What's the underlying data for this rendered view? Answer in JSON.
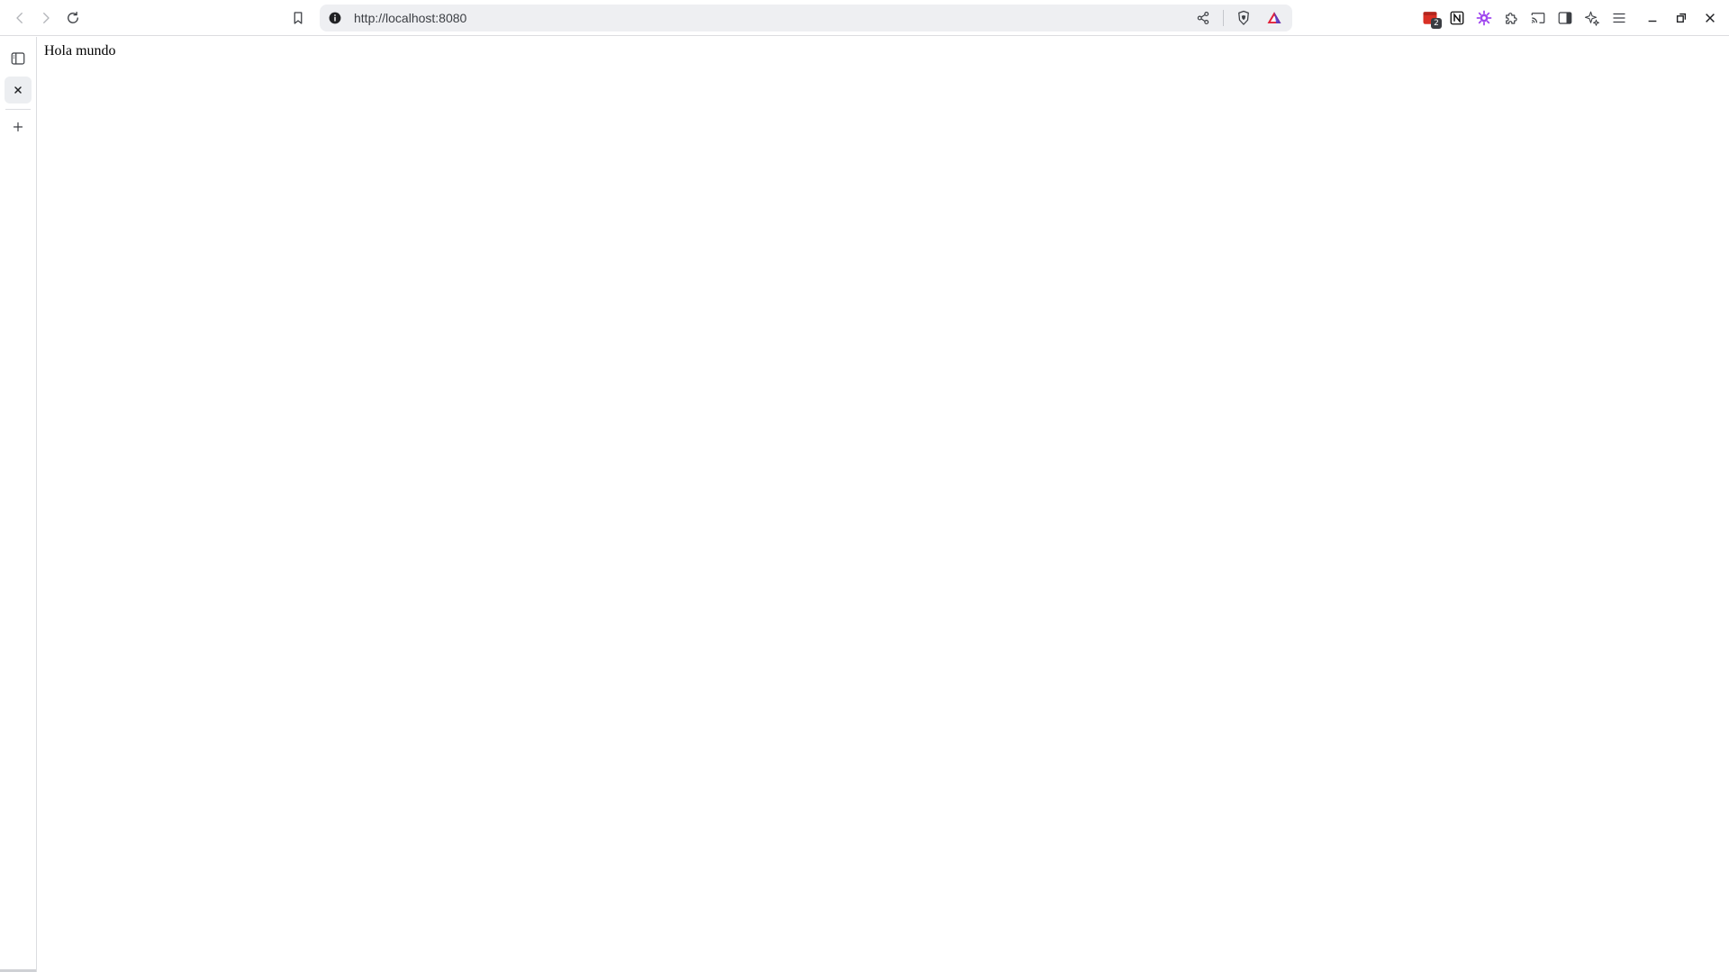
{
  "toolbar": {
    "address": {
      "url": "http://localhost:8080"
    },
    "extensions": [
      {
        "name": "extension-red-icon",
        "badge": "2"
      },
      {
        "name": "notion-icon"
      },
      {
        "name": "extension-purple-icon"
      }
    ]
  },
  "colors": {
    "brave_orange": "#fb542b",
    "rewards_red": "#e1213a",
    "rewards_blue": "#4b3bce",
    "extension_purple": "#a048ef"
  },
  "page": {
    "body_text": "Hola mundo"
  }
}
